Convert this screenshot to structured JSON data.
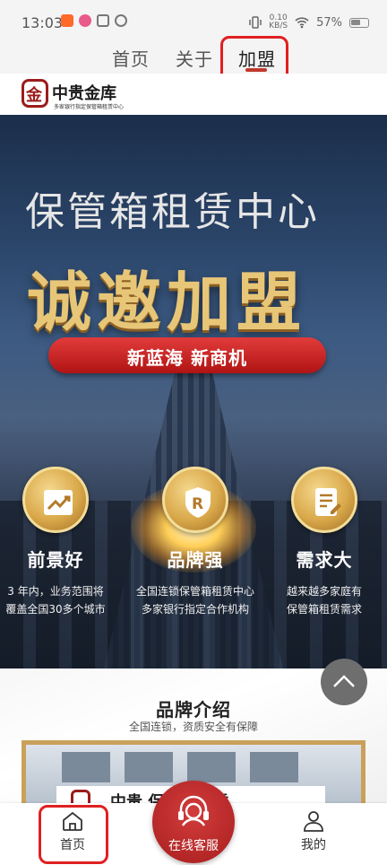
{
  "status_bar": {
    "time": "13:03",
    "net_speed_top": "0.10",
    "net_speed_bottom": "KB/S",
    "battery": "57%"
  },
  "top_nav": {
    "items": [
      "首页",
      "关于",
      "加盟"
    ],
    "active": "加盟"
  },
  "logo": {
    "name": "中贵金库",
    "sub": "多家银行指定保管箱租赁中心"
  },
  "banner": {
    "title_line1": "保管箱租赁中心",
    "title_line2": "诚邀加盟",
    "slogan": "新蓝海 新商机",
    "features": [
      {
        "icon": "trend-chart-icon",
        "title": "前景好",
        "desc_line1": "3 年内，业务范围将",
        "desc_line2": "覆盖全国30多个城市"
      },
      {
        "icon": "brand-r-shield-icon",
        "title": "品牌强",
        "desc_line1": "全国连锁保管箱租赁中心",
        "desc_line2": "多家银行指定合作机构"
      },
      {
        "icon": "document-edit-icon",
        "title": "需求大",
        "desc_line1": "越来越多家庭有",
        "desc_line2": "保管箱租赁需求"
      }
    ]
  },
  "brand_intro": {
    "title": "品牌介绍",
    "subtitle": "全国连锁，资质安全有保障",
    "sign_text": "中贵   保管箱租赁"
  },
  "bottom_bar": {
    "home_label": "首页",
    "service_label": "在线客服",
    "mine_label": "我的"
  },
  "colors": {
    "accent_red": "#b01414",
    "gold": "#e8c678",
    "highlight_box": "#e02020"
  }
}
